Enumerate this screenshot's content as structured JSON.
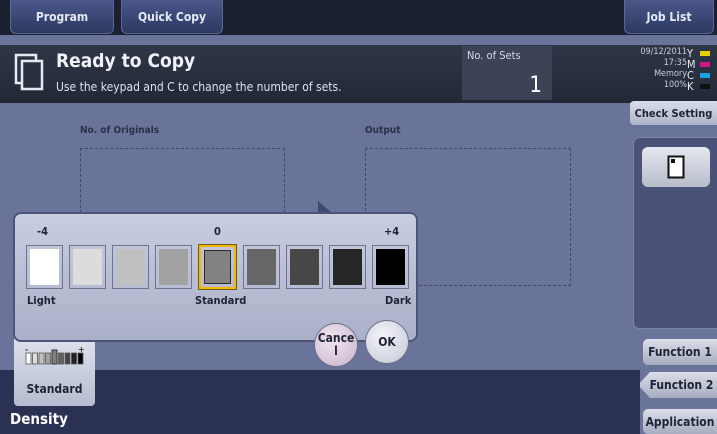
{
  "tabs": {
    "program": "Program",
    "quick_copy": "Quick Copy",
    "job_list": "Job List"
  },
  "status": {
    "title": "Ready to Copy",
    "subtitle": "Use the keypad and C to change the number of sets.",
    "sets_label": "No. of Sets",
    "sets_value": "1",
    "date": "09/12/2011",
    "time": "17:35",
    "memory_label": "Memory",
    "memory_value": "100%",
    "toner": [
      {
        "letter": "Y",
        "color": "#e8d000"
      },
      {
        "letter": "M",
        "color": "#d0168c"
      },
      {
        "letter": "C",
        "color": "#18a0e0"
      },
      {
        "letter": "K",
        "color": "#111111"
      }
    ]
  },
  "right": {
    "check_setting": "Check Setting",
    "function1": "Function 1",
    "function2": "Function 2",
    "application": "Application"
  },
  "main": {
    "originals_label": "No. of Originals",
    "output_label": "Output"
  },
  "density": {
    "title": "Density",
    "card_label": "Standard",
    "min_label": "-4",
    "mid_label": "0",
    "max_label": "+4",
    "light_label": "Light",
    "standard_label": "Standard",
    "dark_label": "Dark",
    "cancel_label": "Cance l",
    "ok_label": "OK",
    "selected_level": 0,
    "levels": [
      {
        "level": -4,
        "color": "#ffffff"
      },
      {
        "level": -3,
        "color": "#dcdcdc"
      },
      {
        "level": -2,
        "color": "#c0c0c0"
      },
      {
        "level": -1,
        "color": "#a2a2a2"
      },
      {
        "level": 0,
        "color": "#828282"
      },
      {
        "level": 1,
        "color": "#666666"
      },
      {
        "level": 2,
        "color": "#474747"
      },
      {
        "level": 3,
        "color": "#262626"
      },
      {
        "level": 4,
        "color": "#000000"
      }
    ]
  }
}
